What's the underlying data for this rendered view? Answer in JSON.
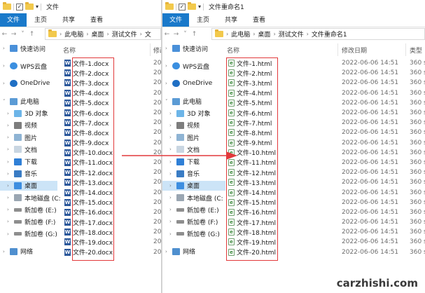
{
  "colors": {
    "ribbon_file_tab": "#1979ca",
    "highlight_box": "#e2393b",
    "arrow": "#e2393b",
    "selected_nav": "#cce4f7"
  },
  "left_window": {
    "title": "文件",
    "tabs": [
      "文件",
      "主页",
      "共享",
      "查看"
    ],
    "breadcrumb": [
      "此电脑",
      "桌面",
      "测试文件",
      "文"
    ],
    "nav": [
      "快速访问",
      "WPS云盘",
      "OneDrive",
      "此电脑",
      "3D 对象",
      "视频",
      "图片",
      "文档",
      "下载",
      "音乐",
      "桌面",
      "本地磁盘 (C:",
      "新加卷 (E:)",
      "新加卷 (F:)",
      "新加卷 (G:)",
      "网络"
    ],
    "columns": {
      "name": "名称",
      "modified": "修改"
    },
    "files": [
      "文件-1.docx",
      "文件-2.docx",
      "文件-3.docx",
      "文件-4.docx",
      "文件-5.docx",
      "文件-6.docx",
      "文件-7.docx",
      "文件-8.docx",
      "文件-9.docx",
      "文件-10.docx",
      "文件-11.docx",
      "文件-12.docx",
      "文件-13.docx",
      "文件-14.docx",
      "文件-15.docx",
      "文件-16.docx",
      "文件-17.docx",
      "文件-18.docx",
      "文件-19.docx",
      "文件-20.docx"
    ],
    "date_prefix": "20"
  },
  "right_window": {
    "title": "文件重命名1",
    "tabs": [
      "文件",
      "主页",
      "共享",
      "查看"
    ],
    "breadcrumb": [
      "此电脑",
      "桌面",
      "测试文件",
      "文件重命名1"
    ],
    "nav": [
      "快速访问",
      "WPS云盘",
      "OneDrive",
      "此电脑",
      "3D 对象",
      "视频",
      "图片",
      "文档",
      "下载",
      "音乐",
      "桌面",
      "本地磁盘 (C:",
      "新加卷 (E:)",
      "新加卷 (F:)",
      "新加卷 (G:)",
      "网络"
    ],
    "columns": {
      "name": "名称",
      "modified": "修改日期",
      "type": "类型"
    },
    "files": [
      "文件-1.html",
      "文件-2.html",
      "文件-3.html",
      "文件-4.html",
      "文件-5.html",
      "文件-6.html",
      "文件-7.html",
      "文件-8.html",
      "文件-9.html",
      "文件-10.html",
      "文件-11.html",
      "文件-12.html",
      "文件-13.html",
      "文件-14.html",
      "文件-15.html",
      "文件-16.html",
      "文件-17.html",
      "文件-18.html",
      "文件-19.html",
      "文件-20.html"
    ],
    "modified": "2022-06-06 14:51",
    "type_prefix": "360 s"
  },
  "watermark": "carzhishi.com"
}
